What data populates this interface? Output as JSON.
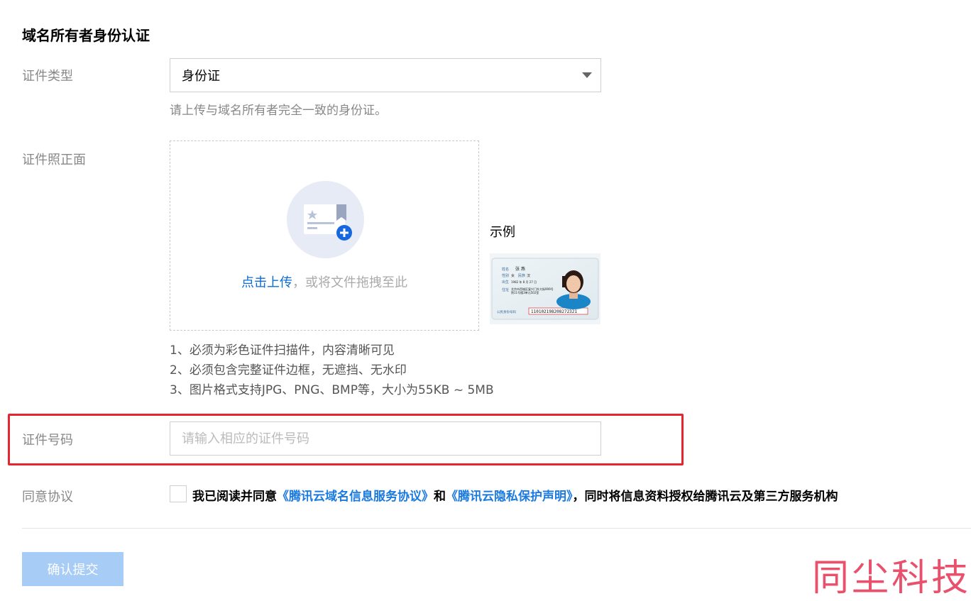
{
  "section": {
    "title": "域名所有者身份认证"
  },
  "fields": {
    "id_type": {
      "label": "证件类型",
      "selected": "身份证",
      "hint": "请上传与域名所有者完全一致的身份证。"
    },
    "id_front": {
      "label": "证件照正面",
      "upload_link": "点击上传",
      "upload_rest": "，或将文件拖拽至此",
      "example_label": "示例",
      "example_card": {
        "name_key": "姓名",
        "name_val": "张 燕",
        "sex_key": "性别",
        "sex_val": "女",
        "nation_key": "民族",
        "nation_val": "汉",
        "birth_key": "出生",
        "birth_val": "1982 年 8 月 27 日",
        "addr_key": "住址",
        "addr_val": "北京市西城区复兴门外大街999号院11号楼3单元502室",
        "id_key": "公民身份号码",
        "id_val": "110102198208272321"
      },
      "requirements": [
        "1、必须为彩色证件扫描件，内容清晰可见",
        "2、必须包含完整证件边框，无遮挡、无水印",
        "3、图片格式支持JPG、PNG、BMP等，大小为55KB ~ 5MB"
      ]
    },
    "id_number": {
      "label": "证件号码",
      "placeholder": "请输入相应的证件号码",
      "value": ""
    },
    "agreement": {
      "label": "同意协议",
      "checked": false,
      "text_before": "我已阅读并同意",
      "link1": "《腾讯云域名信息服务协议》",
      "text_mid": "和",
      "link2": "《腾讯云隐私保护声明》",
      "text_after": "，同时将信息资料授权给腾讯云及第三方服务机构"
    }
  },
  "submit": {
    "label": "确认提交"
  },
  "watermark": "同尘科技",
  "colors": {
    "link": "#0d6bd4",
    "highlight_border": "#e5262e",
    "submit_bg": "#a7cdf6",
    "watermark": "#e8506c"
  }
}
